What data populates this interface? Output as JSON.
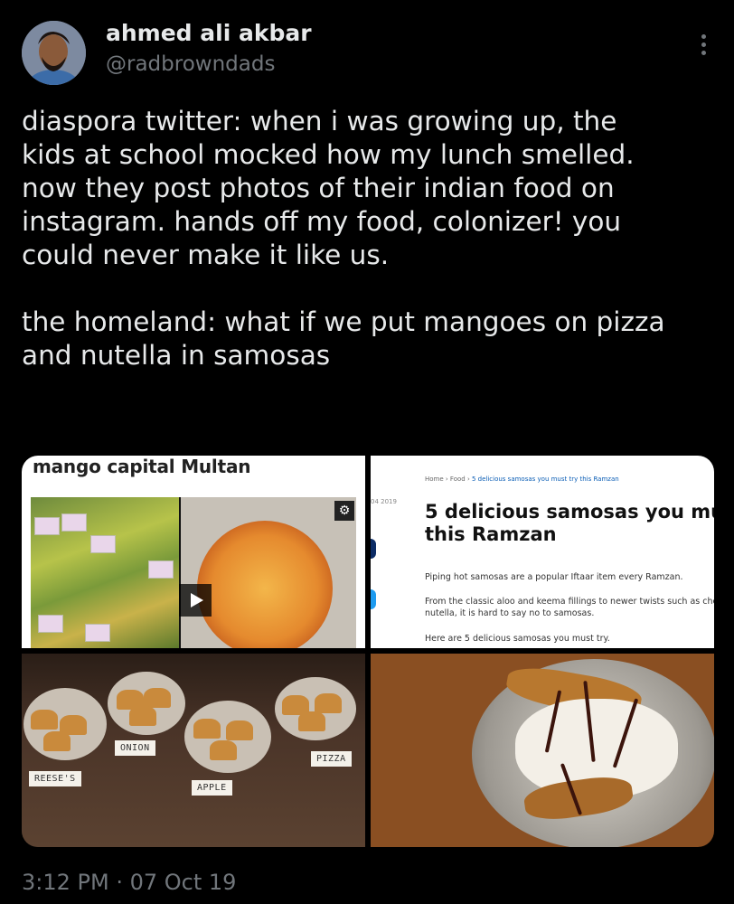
{
  "author": {
    "display_name": "ahmed ali akbar",
    "handle": "@radbrowndads"
  },
  "tweet": {
    "text": "diaspora twitter: when i was growing up, the\nkids at school mocked how my lunch smelled.\nnow they post photos of their indian food on\ninstagram. hands off my food, colonizer! you\ncould never make it like us.\n\nthe homeland: what if we put mangoes on pizza\nand nutella in samosas",
    "timestamp": "3:12 PM · 07 Oct 19"
  },
  "media": {
    "image1": {
      "title": "mango capital Multan",
      "icons": [
        "play-icon",
        "gear-icon"
      ]
    },
    "image2": {
      "breadcrumb_home": "Home",
      "breadcrumb_food": "Food",
      "breadcrumb_current": "5 delicious samosas you must try this Ramzan",
      "date": "04 2019",
      "headline": "5 delicious samosas you mu\nthis Ramzan",
      "paragraph1": "Piping hot samosas are a popular Iftaar item every Ramzan.",
      "paragraph2": "From the classic aloo and keema fillings to newer twists such as chee\nnutella, it is hard to say no to samosas.",
      "paragraph3": "Here are 5 delicious samosas you must try."
    },
    "image3": {
      "label_onion": "ONION",
      "label_reeses": "REESE'S",
      "label_apple": "APPLE",
      "label_pizza": "PIZZA"
    }
  },
  "icons": {
    "more": "more-dots-icon"
  }
}
